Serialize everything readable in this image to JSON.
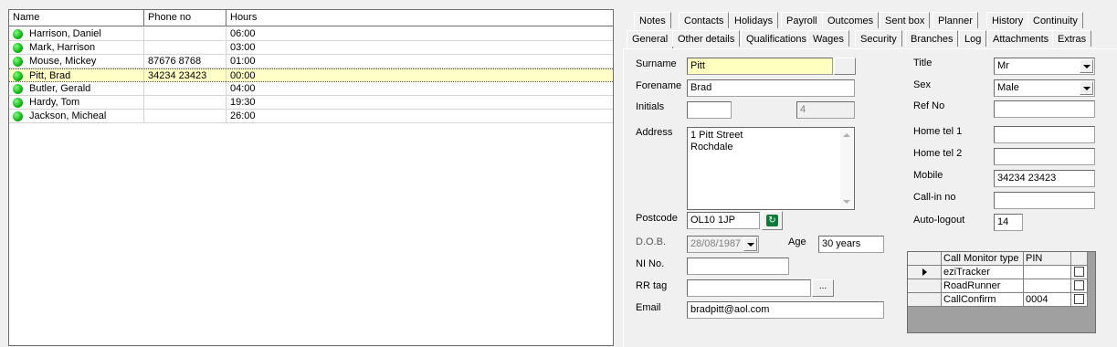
{
  "grid": {
    "columns": [
      "Name",
      "Phone no",
      "Hours"
    ],
    "rows": [
      {
        "name": "Harrison, Daniel",
        "phone": "",
        "hours": "06:00",
        "selected": false
      },
      {
        "name": "Mark, Harrison",
        "phone": "",
        "hours": "03:00",
        "selected": false
      },
      {
        "name": "Mouse, Mickey",
        "phone": "87676 8768",
        "hours": "01:00",
        "selected": false
      },
      {
        "name": "Pitt, Brad",
        "phone": "34234 23423",
        "hours": "00:00",
        "selected": true
      },
      {
        "name": "Butler, Gerald",
        "phone": "",
        "hours": "04:00",
        "selected": false
      },
      {
        "name": "Hardy, Tom",
        "phone": "",
        "hours": "19:30",
        "selected": false
      },
      {
        "name": "Jackson, Micheal",
        "phone": "",
        "hours": "26:00",
        "selected": false
      }
    ]
  },
  "tabs_row1": [
    "Notes",
    "Contacts",
    "Holidays",
    "Payroll",
    "Outcomes",
    "Sent box",
    "Planner",
    "History",
    "Continuity"
  ],
  "tabs_row2": [
    "General",
    "Other details",
    "Qualifications",
    "Wages",
    "Security",
    "Branches",
    "Log",
    "Attachments",
    "Extras"
  ],
  "form": {
    "surname_label": "Surname",
    "surname": "Pitt",
    "forename_label": "Forename",
    "forename": "Brad",
    "initials_label": "Initials",
    "initials": "",
    "initials_count": "4",
    "address_label": "Address",
    "address_line1": "1 Pitt Street",
    "address_line2": "Rochdale",
    "postcode_label": "Postcode",
    "postcode": "OL10 1JP",
    "dob_label": "D.O.B.",
    "dob": "28/08/1987",
    "age_label": "Age",
    "age": "30 years",
    "ni_label": "NI No.",
    "ni": "",
    "rrtag_label": "RR tag",
    "rrtag": "",
    "rrtag_button": "...",
    "email_label": "Email",
    "email": "bradpitt@aol.com",
    "title_label": "Title",
    "title": "Mr",
    "sex_label": "Sex",
    "sex": "Male",
    "refno_label": "Ref No",
    "refno": "",
    "hometel1_label": "Home tel 1",
    "hometel1": "",
    "hometel2_label": "Home tel 2",
    "hometel2": "",
    "mobile_label": "Mobile",
    "mobile": "34234 23423",
    "callin_label": "Call-in no",
    "callin": "",
    "autologout_label": "Auto-logout",
    "autologout": "14"
  },
  "call_monitor": {
    "headers": [
      "Call Monitor type",
      "PIN"
    ],
    "rows": [
      {
        "type": "eziTracker",
        "pin": "",
        "current": true
      },
      {
        "type": "RoadRunner",
        "pin": "",
        "current": false
      },
      {
        "type": "CallConfirm",
        "pin": "0004",
        "current": false
      }
    ]
  }
}
